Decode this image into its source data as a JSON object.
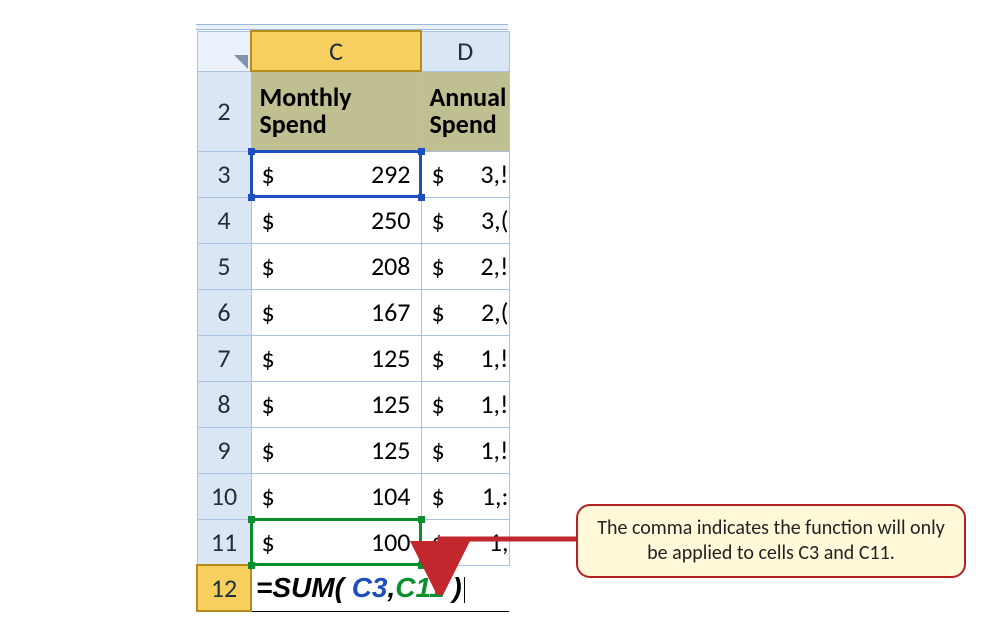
{
  "columns": {
    "c": "C",
    "d": "D"
  },
  "headerRow": {
    "num": "2",
    "c": "Monthly Spend",
    "d": "Annual Spend"
  },
  "rows": [
    {
      "num": "3",
      "c_cur": "$",
      "c_amt": "292",
      "d_cur": "$",
      "d_amt": "3,!"
    },
    {
      "num": "4",
      "c_cur": "$",
      "c_amt": "250",
      "d_cur": "$",
      "d_amt": "3,("
    },
    {
      "num": "5",
      "c_cur": "$",
      "c_amt": "208",
      "d_cur": "$",
      "d_amt": "2,!"
    },
    {
      "num": "6",
      "c_cur": "$",
      "c_amt": "167",
      "d_cur": "$",
      "d_amt": "2,("
    },
    {
      "num": "7",
      "c_cur": "$",
      "c_amt": "125",
      "d_cur": "$",
      "d_amt": "1,!"
    },
    {
      "num": "8",
      "c_cur": "$",
      "c_amt": "125",
      "d_cur": "$",
      "d_amt": "1,!"
    },
    {
      "num": "9",
      "c_cur": "$",
      "c_amt": "125",
      "d_cur": "$",
      "d_amt": "1,!"
    },
    {
      "num": "10",
      "c_cur": "$",
      "c_amt": "104",
      "d_cur": "$",
      "d_amt": "1,:"
    },
    {
      "num": "11",
      "c_cur": "$",
      "c_amt": "100",
      "d_cur": "$",
      "d_amt": "1,"
    }
  ],
  "formulaRow": {
    "num": "12",
    "eq": "=",
    "fn": "SUM",
    "open": "(",
    "sp": " ",
    "ref1": "C3",
    "comma": ",",
    "ref2": "C11",
    "close": ")"
  },
  "callout": "The comma indicates the function will only be applied to cells C3 and C11."
}
